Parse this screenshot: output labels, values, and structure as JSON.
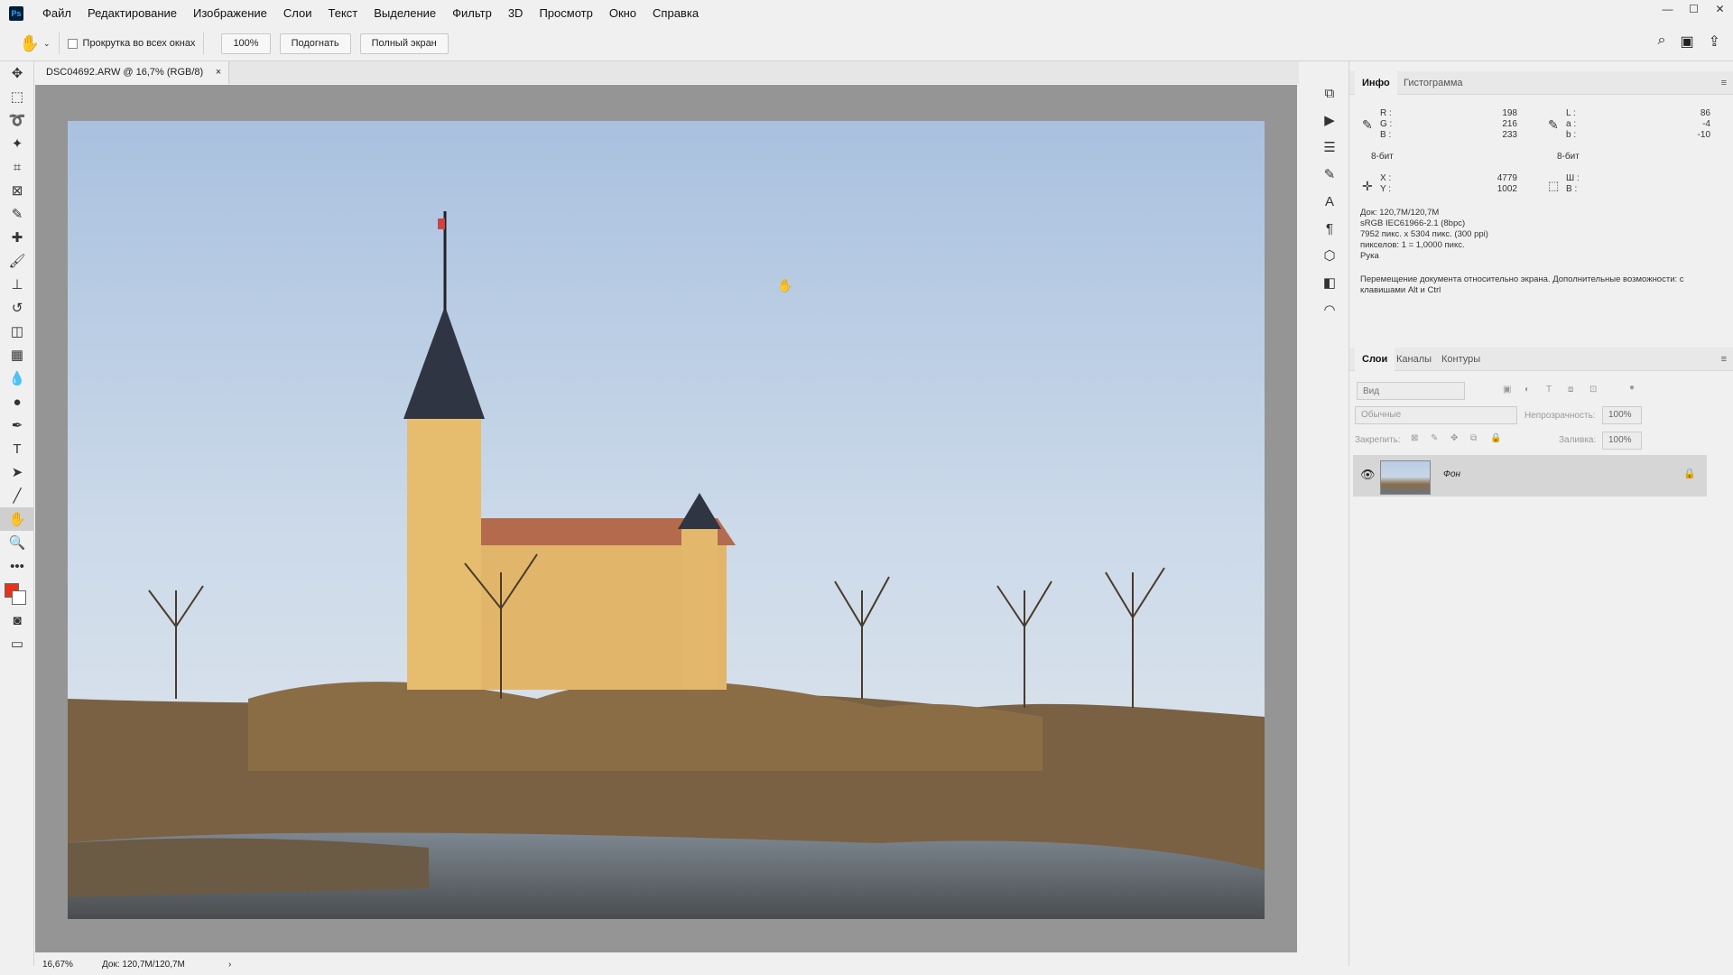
{
  "app": {
    "logo": "Ps"
  },
  "menu": [
    "Файл",
    "Редактирование",
    "Изображение",
    "Слои",
    "Текст",
    "Выделение",
    "Фильтр",
    "3D",
    "Просмотр",
    "Окно",
    "Справка"
  ],
  "options": {
    "scroll_all": "Прокрутка во всех окнах",
    "zoom": "100%",
    "fit": "Подогнать",
    "fullscreen": "Полный экран"
  },
  "document": {
    "tab_title": "DSC04692.ARW @ 16,7% (RGB/8)",
    "close": "×",
    "status_zoom": "16,67%",
    "status_doc": "Док: 120,7M/120,7M",
    "status_arrow": "›"
  },
  "info_panel": {
    "tabs": [
      "Инфо",
      "Гистограмма"
    ],
    "r_label": "R :",
    "g_label": "G :",
    "b_label": "B :",
    "r": "198",
    "g": "216",
    "b": "233",
    "l_label": "L :",
    "a_label": "a :",
    "b2_label": "b :",
    "l": "86",
    "a": "-4",
    "b2": "-10",
    "bits_left": "8-бит",
    "bits_right": "8-бит",
    "x_label": "X :",
    "y_label": "Y :",
    "x": "4779",
    "y": "1002",
    "w_label": "Ш :",
    "h_label": "В :",
    "doc_info": "Док: 120,7M/120,7M",
    "profile": "sRGB IEC61966-2.1 (8bpc)",
    "dimensions": "7952 пикс. x 5304 пикс. (300 ppi)",
    "pixels": "пикселов: 1 = 1,0000 пикс.",
    "tool": "Рука",
    "hint": "Перемещение документа относительно экрана. Дополнительные возможности: с клавишами Alt и Ctrl"
  },
  "layers_panel": {
    "tabs": [
      "Слои",
      "Каналы",
      "Контуры"
    ],
    "search_placeholder": "Вид",
    "blend_mode": "Обычные",
    "opacity_label": "Непрозрачность:",
    "opacity": "100%",
    "lock_label": "Закрепить:",
    "fill_label": "Заливка:",
    "fill": "100%",
    "layers": [
      {
        "name": "Фон"
      }
    ]
  },
  "colors": {
    "foreground": "#e8321b",
    "background": "#ffffff"
  }
}
